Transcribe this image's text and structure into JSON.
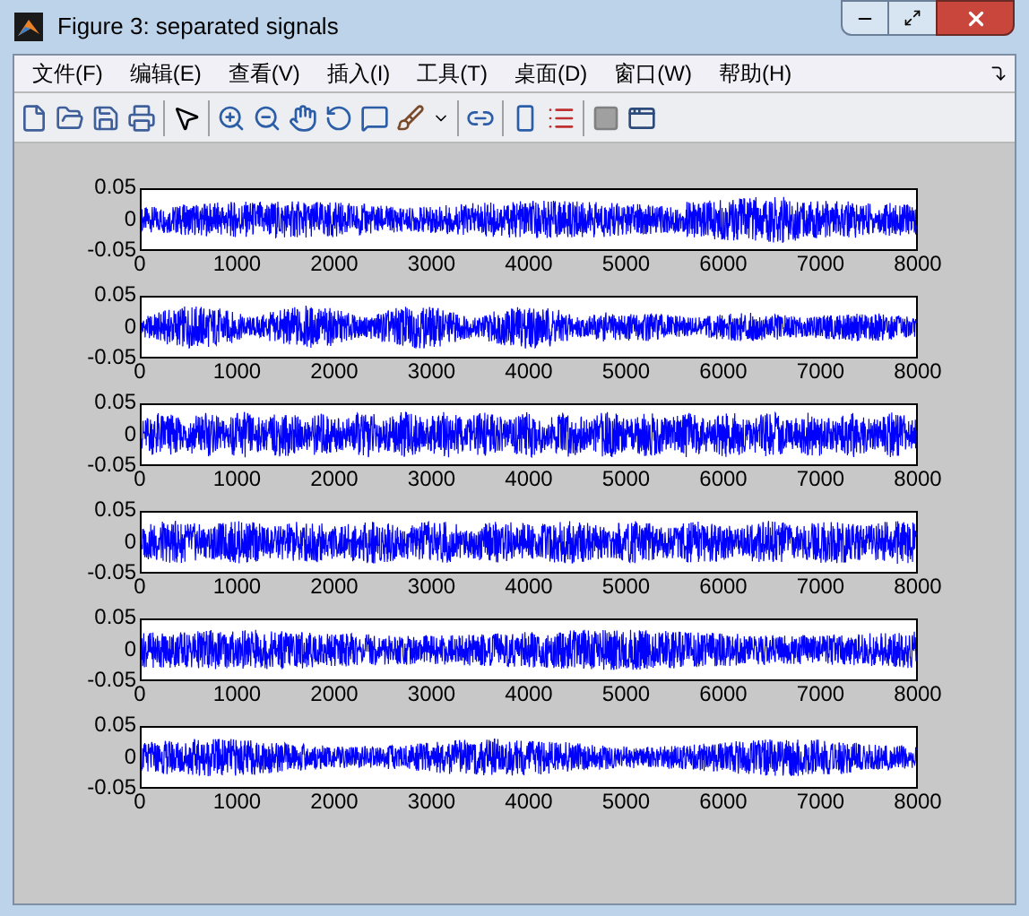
{
  "window": {
    "title": "Figure 3: separated signals"
  },
  "menu": [
    "文件(F)",
    "编辑(E)",
    "查看(V)",
    "插入(I)",
    "工具(T)",
    "桌面(D)",
    "窗口(W)",
    "帮助(H)"
  ],
  "plots": [
    {
      "yticks": [
        "0.05",
        "0",
        "-0.05"
      ],
      "xticks": [
        "0",
        "1000",
        "2000",
        "3000",
        "4000",
        "5000",
        "6000",
        "7000",
        "8000"
      ]
    },
    {
      "yticks": [
        "0.05",
        "0",
        "-0.05"
      ],
      "xticks": [
        "0",
        "1000",
        "2000",
        "3000",
        "4000",
        "5000",
        "6000",
        "7000",
        "8000"
      ]
    },
    {
      "yticks": [
        "0.05",
        "0",
        "-0.05"
      ],
      "xticks": [
        "0",
        "1000",
        "2000",
        "3000",
        "4000",
        "5000",
        "6000",
        "7000",
        "8000"
      ]
    },
    {
      "yticks": [
        "0.05",
        "0",
        "-0.05"
      ],
      "xticks": [
        "0",
        "1000",
        "2000",
        "3000",
        "4000",
        "5000",
        "6000",
        "7000",
        "8000"
      ]
    },
    {
      "yticks": [
        "0.05",
        "0",
        "-0.05"
      ],
      "xticks": [
        "0",
        "1000",
        "2000",
        "3000",
        "4000",
        "5000",
        "6000",
        "7000",
        "8000"
      ]
    },
    {
      "yticks": [
        "0.05",
        "0",
        "-0.05"
      ],
      "xticks": [
        "0",
        "1000",
        "2000",
        "3000",
        "4000",
        "5000",
        "6000",
        "7000",
        "8000"
      ]
    }
  ]
}
